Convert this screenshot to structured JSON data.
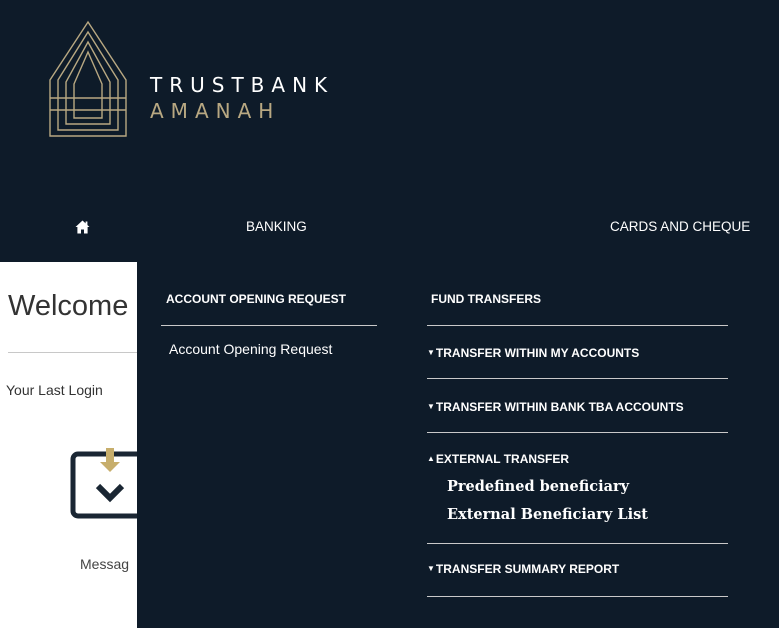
{
  "brand": {
    "name_line1": "TRUSTBANK",
    "name_line2": "AMANAH",
    "accent_color": "#b8a882",
    "bg_color": "#0e1b29"
  },
  "nav": {
    "home_icon": "home-icon",
    "items": [
      "BANKING",
      "CARDS AND CHEQUE"
    ]
  },
  "main": {
    "welcome": "Welcome",
    "last_login": "Your Last Login",
    "messages_label": "Messag",
    "messages_icon": "inbox-download-icon"
  },
  "menu": {
    "col1": {
      "heading": "ACCOUNT OPENING REQUEST",
      "links": [
        "Account Opening Request"
      ]
    },
    "col2": {
      "heading": "FUND TRANSFERS",
      "sections": [
        {
          "caret": "▼",
          "label": "TRANSFER WITHIN MY ACCOUNTS"
        },
        {
          "caret": "▼",
          "label": "TRANSFER WITHIN BANK TBA ACCOUNTS"
        },
        {
          "caret": "▲",
          "label": "EXTERNAL TRANSFER",
          "links": [
            "Predefined beneficiary",
            "External Beneficiary List"
          ]
        },
        {
          "caret": "▼",
          "label": "TRANSFER SUMMARY REPORT"
        }
      ]
    }
  }
}
